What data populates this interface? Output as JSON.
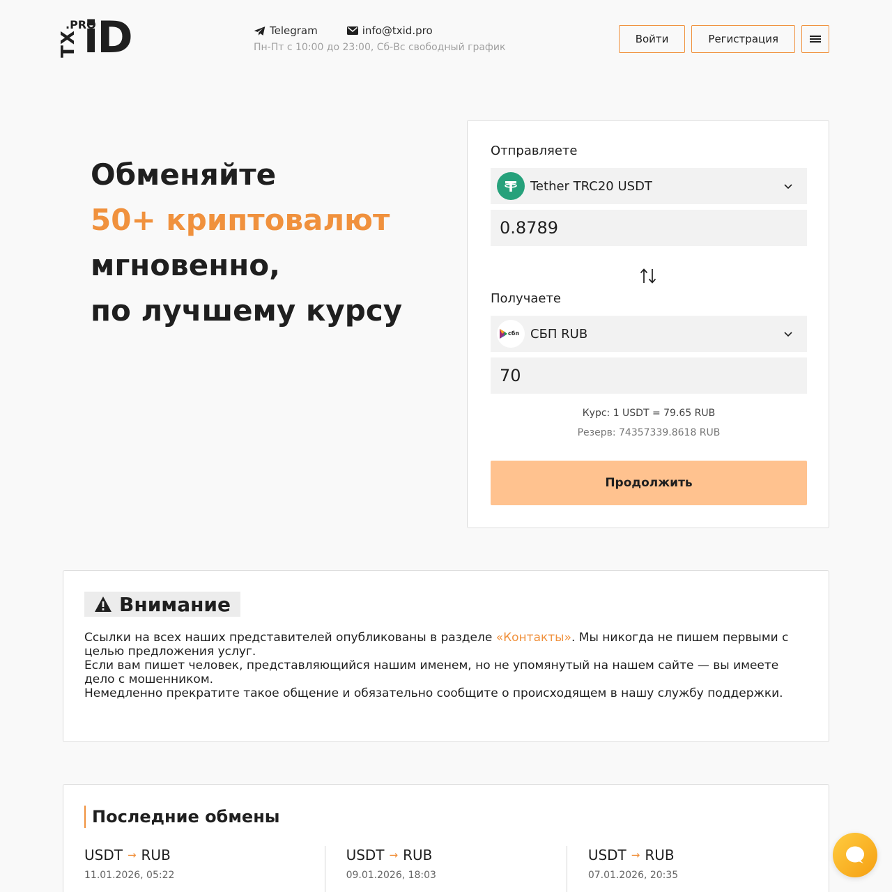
{
  "header": {
    "logo": {
      "pro": ".PRO",
      "tx": "TX",
      "id": "iD"
    },
    "telegram_label": "Telegram",
    "email_label": "info@txid.pro",
    "hours": "Пн-Пт с 10:00 до 23:00, Сб-Вс свободный график",
    "login_label": "Войти",
    "register_label": "Регистрация"
  },
  "hero": {
    "line1": "Обменяйте",
    "line2": "50+ криптовалют",
    "line3": "мгновенно,",
    "line4": "по лучшему курсу"
  },
  "exchange": {
    "send_label": "Отправляете",
    "send_currency": "Tether TRC20 USDT",
    "send_amount": "0.8789",
    "receive_label": "Получаете",
    "receive_currency": "СБП RUB",
    "receive_amount": "70",
    "rate": "Курс: 1 USDT = 79.65 RUB",
    "reserve": "Резерв: 74357339.8618 RUB",
    "continue_label": "Продолжить",
    "send_icon_color": "#26a17b",
    "sbp_icon_text": "сбп"
  },
  "warning": {
    "title": "Внимание",
    "p1_before": "Ссылки на всех наших представителей опубликованы в разделе ",
    "p1_link": "«Контакты»",
    "p1_after": ". Мы никогда не пишем первыми с целью предложения услуг.",
    "p2": "Если вам пишет человек, представляющийся нашим именем, но не упомянутый на нашем сайте — вы имеете дело с мошенником.",
    "p3": "Немедленно прекратите такое общение и обязательно сообщите о происходящем в нашу службу поддержки."
  },
  "recent": {
    "title": "Последние обмены",
    "items": [
      {
        "from": "USDT",
        "to": "RUB",
        "date": "11.01.2026, 05:22"
      },
      {
        "from": "USDT",
        "to": "RUB",
        "date": "09.01.2026, 18:03"
      },
      {
        "from": "USDT",
        "to": "RUB",
        "date": "07.01.2026, 20:35"
      }
    ]
  },
  "colors": {
    "accent": "#f0913d",
    "button": "#ffc28f",
    "chat": "#f5a623"
  }
}
